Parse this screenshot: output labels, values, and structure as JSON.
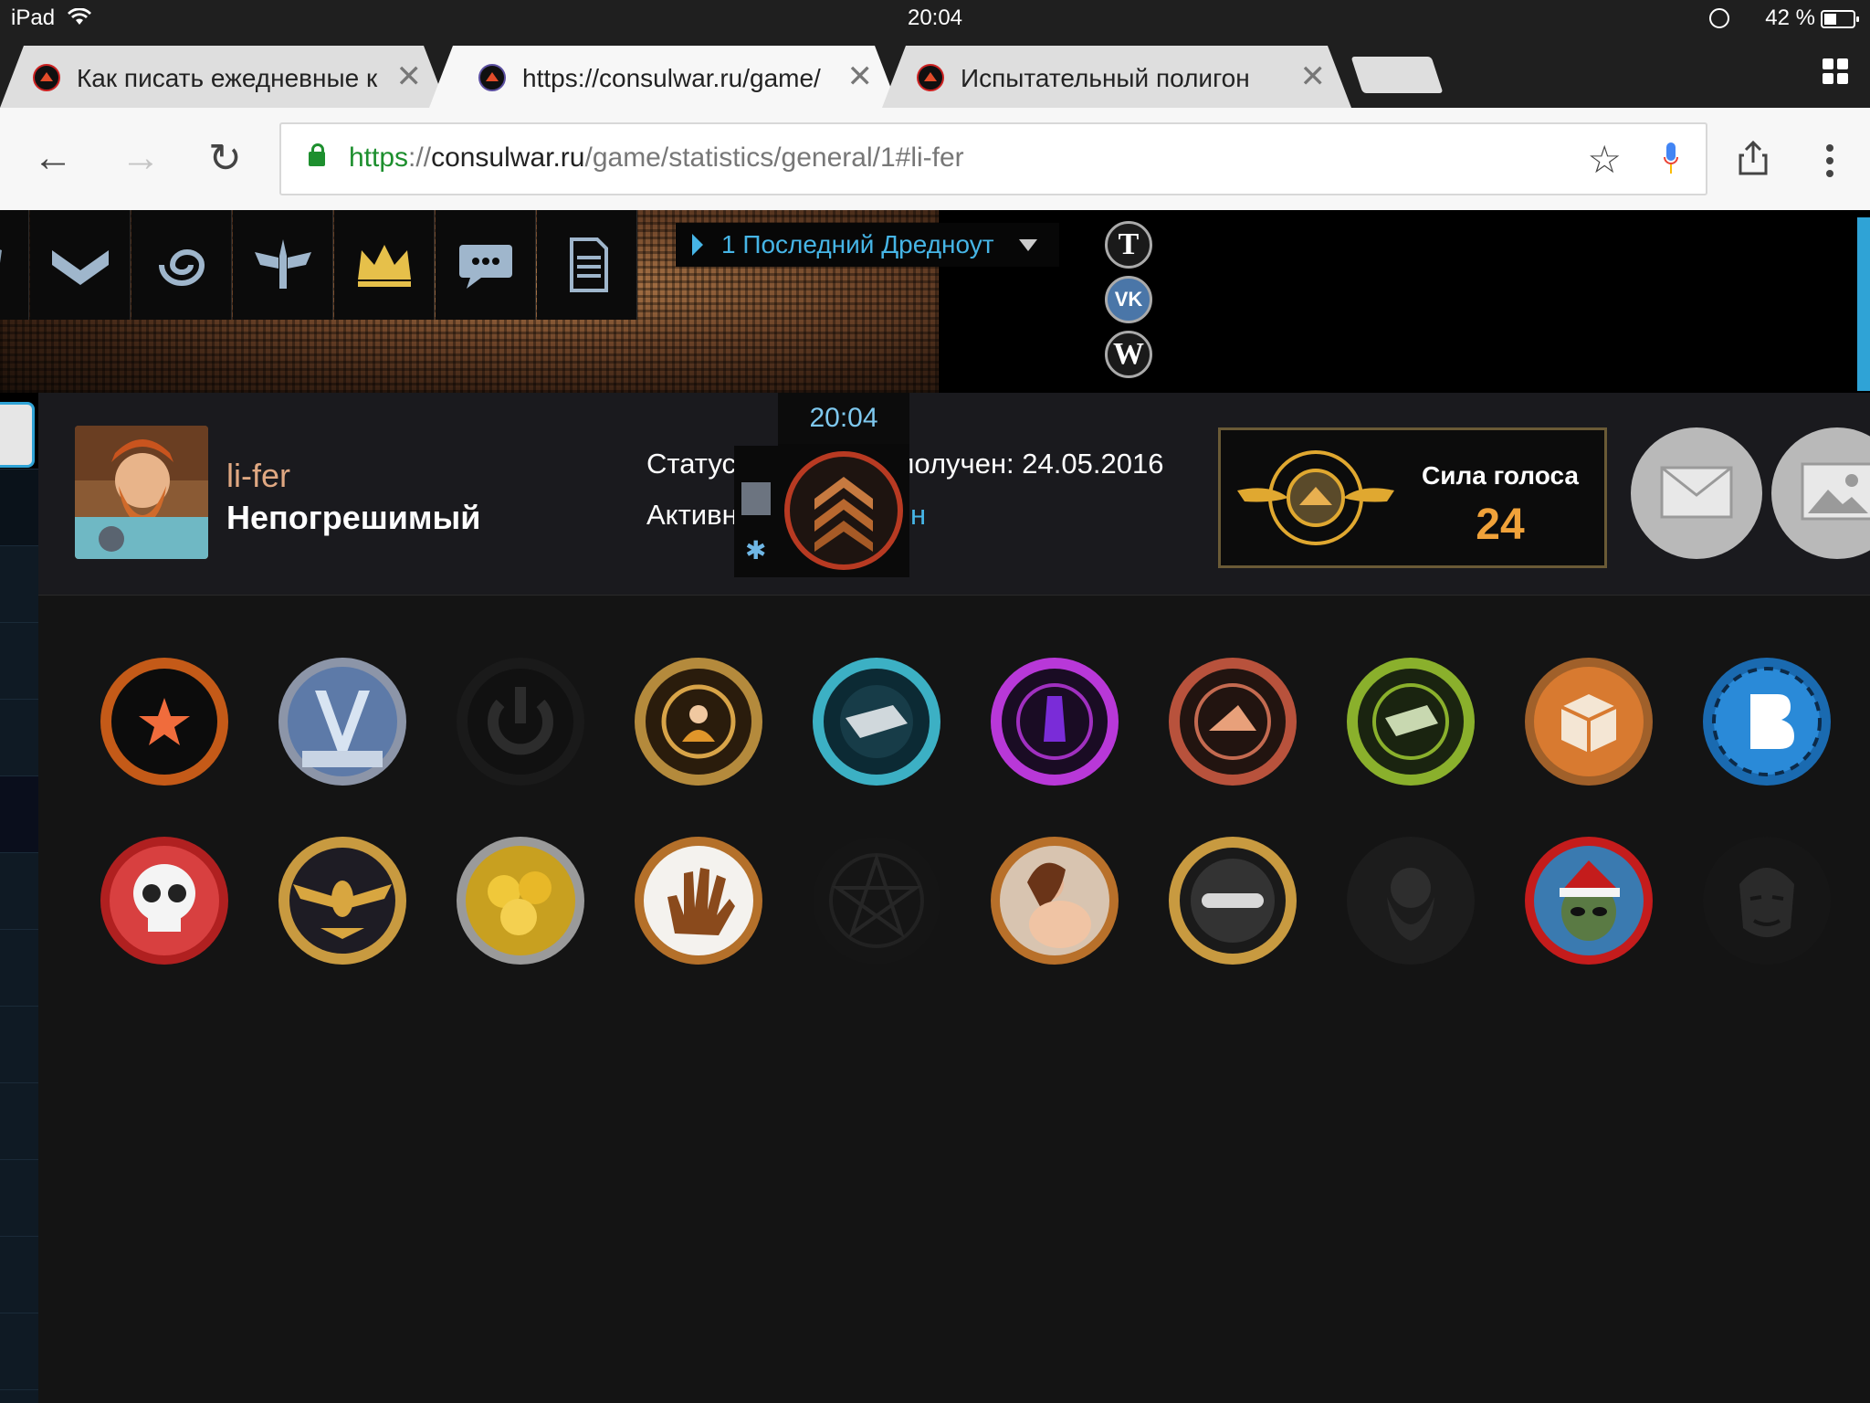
{
  "status_bar": {
    "device": "iPad",
    "time": "20:04",
    "battery": "42 %"
  },
  "tabs": [
    {
      "title": "Как писать ежедневные к",
      "active": false
    },
    {
      "title": "https://consulwar.ru/game/",
      "active": true
    },
    {
      "title": "Испытательный полигон",
      "active": false
    }
  ],
  "omnibox": {
    "scheme": "https",
    "sep": "://",
    "host": "consulwar.ru",
    "path": "/game/statistics/general/1#li-fer"
  },
  "game_menu": {
    "icons": [
      "shield-icon",
      "chevron-icon",
      "galaxy-icon",
      "winged-sword-icon",
      "crown-icon",
      "chat-icon",
      "document-icon"
    ]
  },
  "fleet_select": {
    "label": "1 Последний Дредноут"
  },
  "social": {
    "t": "T",
    "vk": "VK",
    "w": "W"
  },
  "profile": {
    "username": "li-fer",
    "rank_title": "Непогрешимый",
    "status_prefix": "Статус",
    "status_suffix": " получен: 24.05.2016",
    "activity_prefix": "Активн",
    "activity_suffix": "ен",
    "clock": "20:04",
    "vote": {
      "label": "Сила голоса",
      "value": "24"
    }
  },
  "achievements": {
    "row1": [
      "star-medal",
      "station-medal",
      "power-medal",
      "commander-medal",
      "silver-bar-medal",
      "crystal-medal",
      "pyramid-medal",
      "money-medal",
      "cubes-medal",
      "vk-medal"
    ],
    "row2": [
      "skull-medal",
      "eagle-medal",
      "gold-coins-medal",
      "hand-medal",
      "pentagram-medal",
      "portrait-medal",
      "minus-medal",
      "old-man-medal",
      "santa-alien-medal",
      "mask-medal"
    ]
  },
  "colors": {
    "accent": "#46b5e6",
    "gold": "#f0a23a",
    "username": "#e0a882"
  }
}
